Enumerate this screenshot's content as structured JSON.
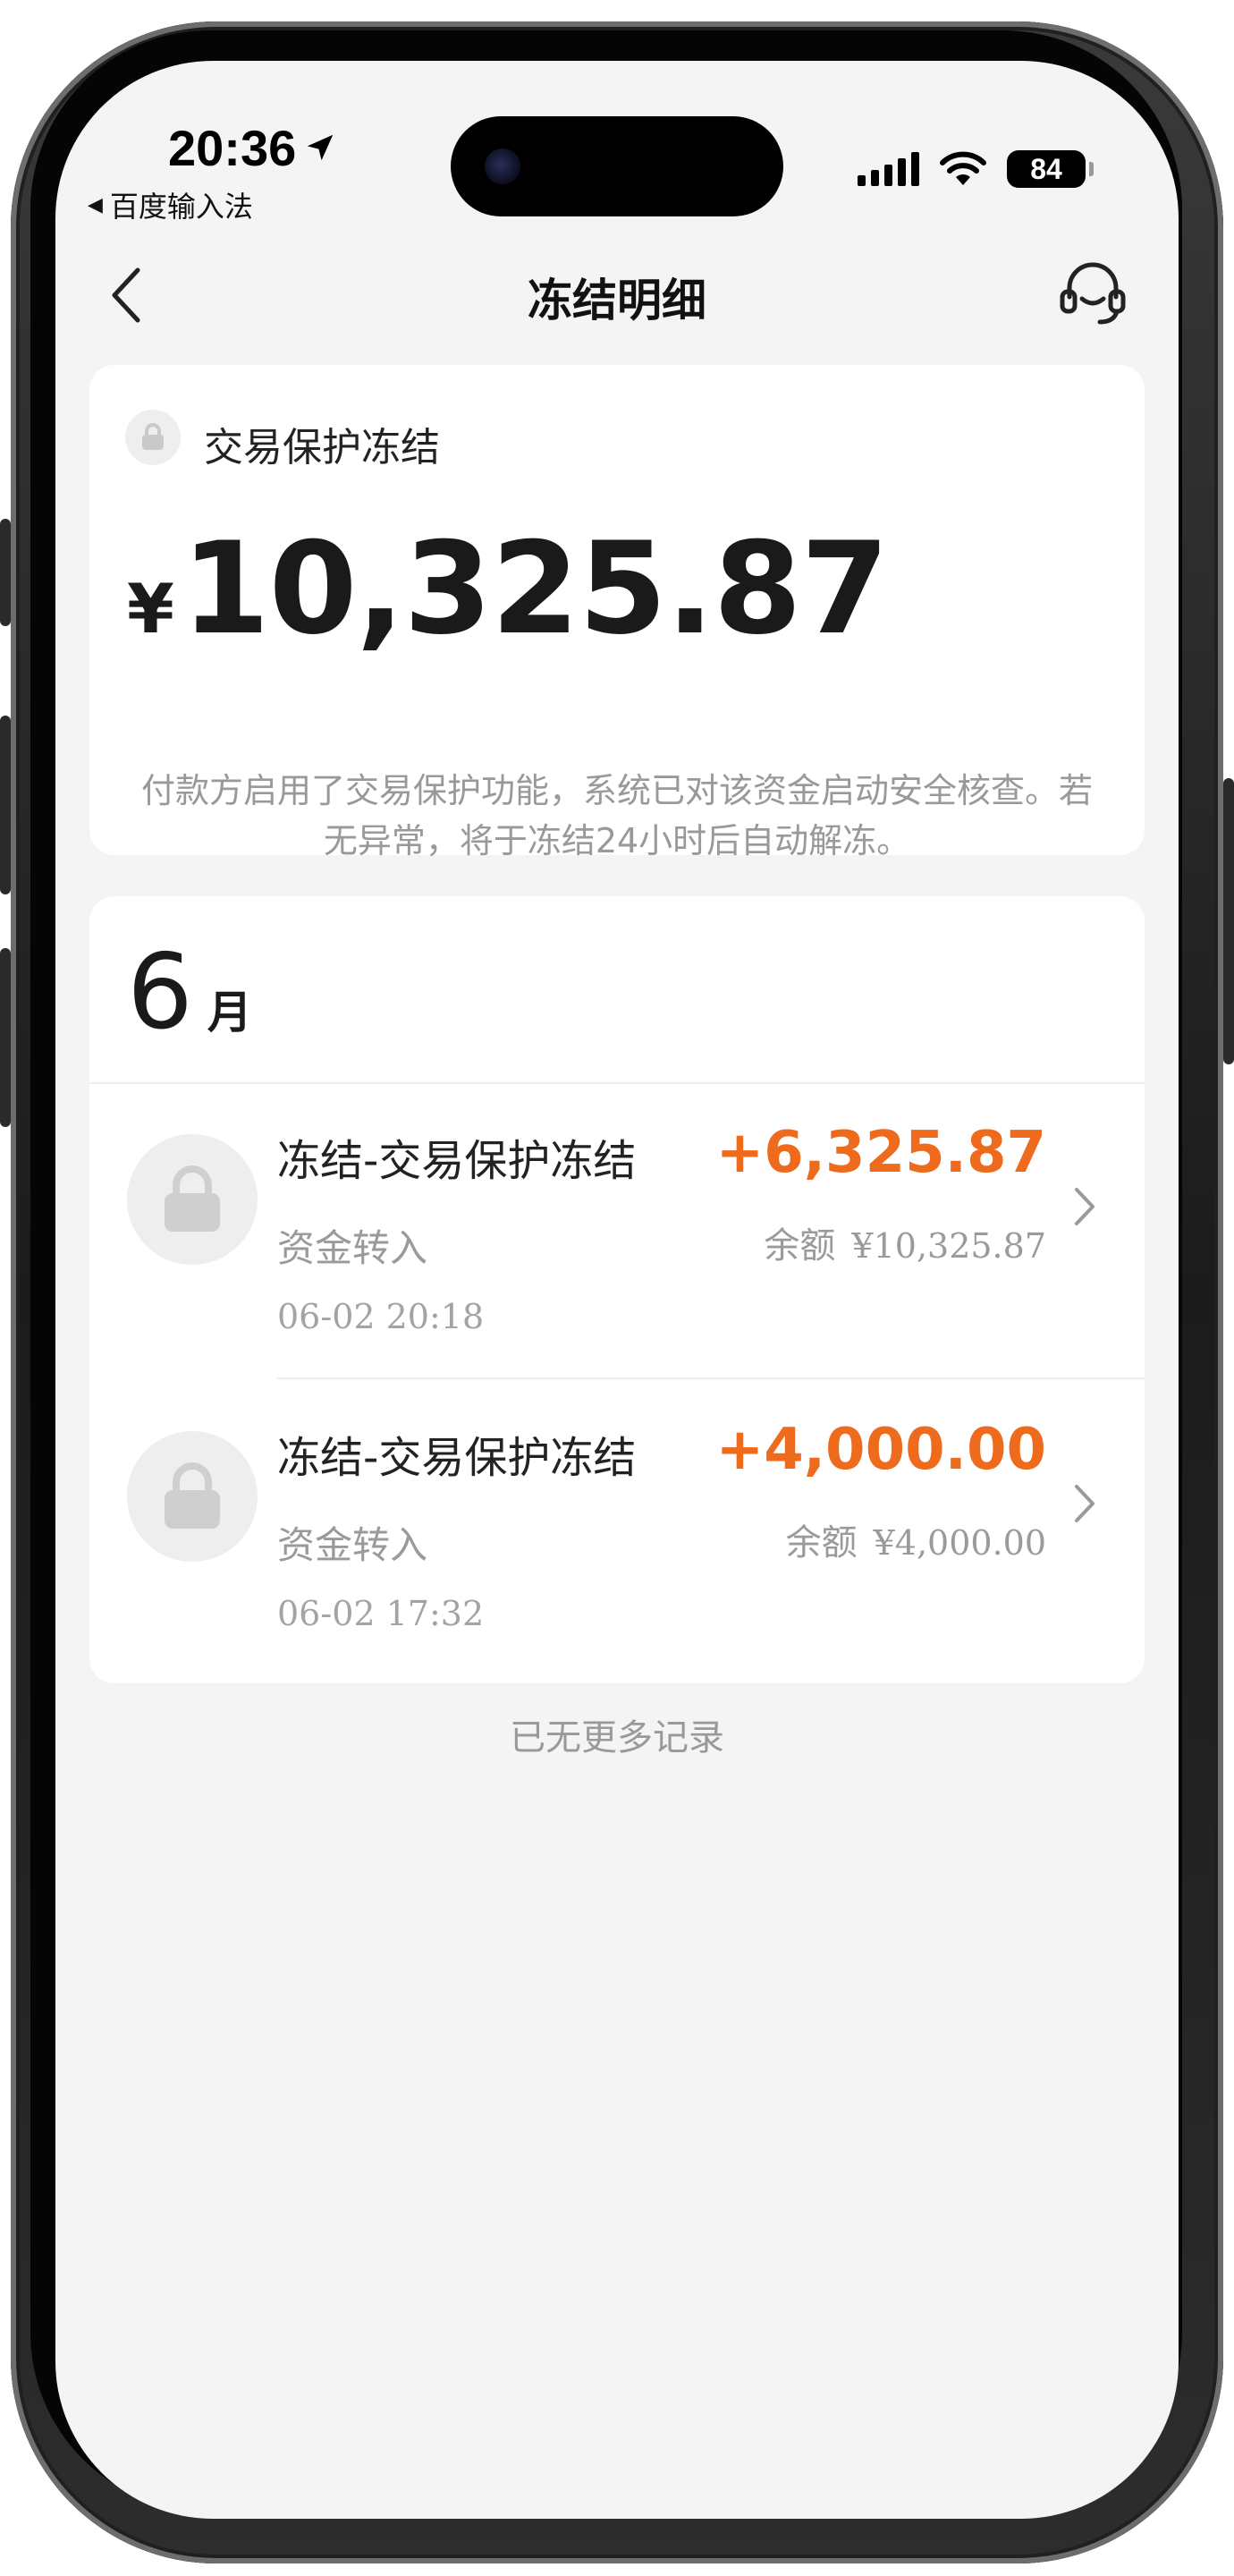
{
  "status_bar": {
    "time": "20:36",
    "back_app": "百度输入法",
    "battery": "84"
  },
  "nav": {
    "title": "冻结明细"
  },
  "summary": {
    "label": "交易保护冻结",
    "currency": "¥",
    "amount": "10,325.87",
    "notice": "付款方启用了交易保护功能，系统已对该资金启动安全核查。若无异常，将于冻结24小时后自动解冻。"
  },
  "month_header": {
    "number": "6",
    "unit": "月"
  },
  "records": [
    {
      "title": "冻结-交易保护冻结",
      "subtitle": "资金转入",
      "time": "06-02 20:18",
      "amount": "+6,325.87",
      "balance_label": "余额",
      "balance": "¥10,325.87"
    },
    {
      "title": "冻结-交易保护冻结",
      "subtitle": "资金转入",
      "time": "06-02 17:32",
      "amount": "+4,000.00",
      "balance_label": "余额",
      "balance": "¥4,000.00"
    }
  ],
  "footer": {
    "end_text": "已无更多记录"
  },
  "colors": {
    "accent_amount": "#ee6a1c",
    "background": "#f4f4f4",
    "card": "#ffffff"
  }
}
